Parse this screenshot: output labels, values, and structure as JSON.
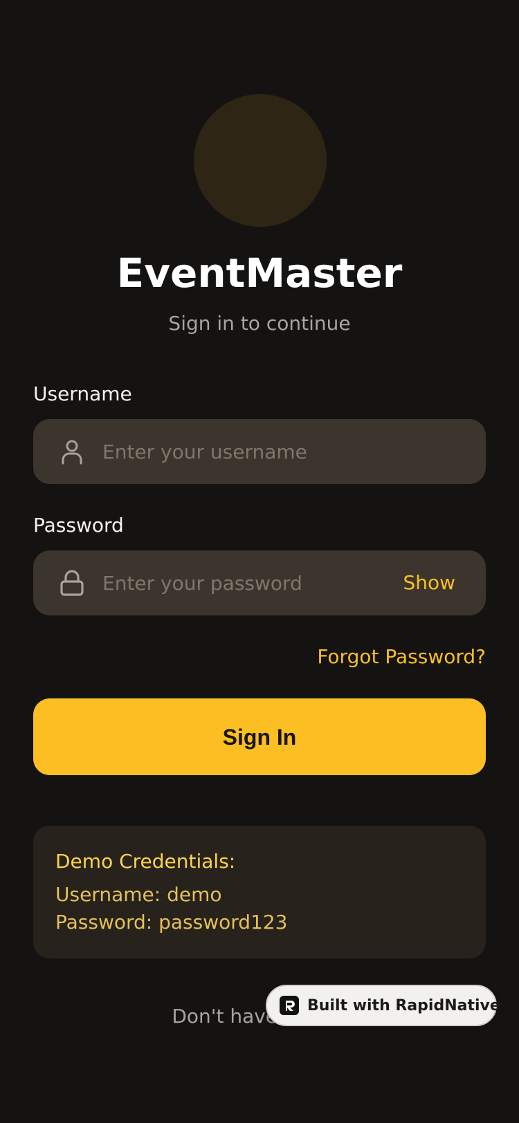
{
  "app": {
    "title": "EventMaster",
    "subtitle": "Sign in to continue"
  },
  "form": {
    "username": {
      "label": "Username",
      "placeholder": "Enter your username",
      "value": "",
      "icon": "user-icon"
    },
    "password": {
      "label": "Password",
      "placeholder": "Enter your password",
      "value": "",
      "icon": "lock-icon",
      "toggle_label": "Show"
    },
    "forgot_label": "Forgot Password?",
    "submit_label": "Sign In"
  },
  "demo": {
    "title": "Demo Credentials:",
    "username_line": "Username: demo",
    "password_line": "Password: password123"
  },
  "signup": {
    "prompt": "Don't have an acc",
    "link_label": ""
  },
  "badge": {
    "label": "Built with RapidNative",
    "icon": "rapidnative-logo-icon"
  },
  "colors": {
    "background": "#141311",
    "accent": "#fbbf24",
    "field_bg": "#3c352d",
    "demo_bg": "#27221c",
    "logo_circle": "#2e2514"
  }
}
